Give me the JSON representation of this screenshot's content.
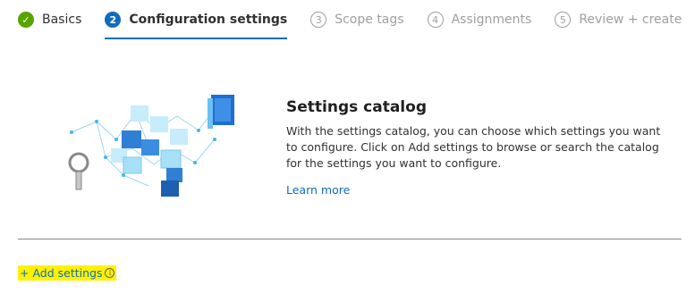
{
  "wizard": {
    "steps": [
      {
        "number": "✓",
        "label": "Basics",
        "state": "done"
      },
      {
        "number": "2",
        "label": "Configuration settings",
        "state": "active"
      },
      {
        "number": "3",
        "label": "Scope tags",
        "state": "todo"
      },
      {
        "number": "4",
        "label": "Assignments",
        "state": "todo"
      },
      {
        "number": "5",
        "label": "Review + create",
        "state": "todo"
      }
    ]
  },
  "catalog": {
    "title": "Settings catalog",
    "description": "With the settings catalog, you can choose which settings you want to configure. Click on Add settings to browse or search the catalog for the settings you want to configure.",
    "learn_more": "Learn more",
    "illustration_icon": "settings-catalog-illustration"
  },
  "actions": {
    "add_settings": "+ Add settings",
    "info_glyph": "i"
  },
  "colors": {
    "accent": "#0f6cbd",
    "success": "#57a300",
    "highlight": "#fff200"
  }
}
